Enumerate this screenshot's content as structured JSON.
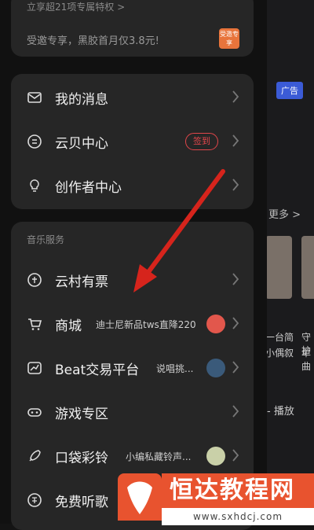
{
  "promo": {
    "line1": "立享超21项专属特权 >",
    "line2": "受邀专享，黑胶首月仅3.8元!",
    "badge": "受邀专享"
  },
  "menu_main": [
    {
      "label": "我的消息",
      "icon": "mail-icon"
    },
    {
      "label": "云贝中心",
      "icon": "coin-icon",
      "badge": "签到"
    },
    {
      "label": "创作者中心",
      "icon": "bulb-icon"
    }
  ],
  "music_services": {
    "title": "音乐服务",
    "items": [
      {
        "label": "云村有票",
        "icon": "ticket-icon"
      },
      {
        "label": "商城",
        "icon": "cart-icon",
        "note": "迪士尼新品tws直降220"
      },
      {
        "label": "Beat交易平台",
        "icon": "chart-icon",
        "note": "说唱挑..."
      },
      {
        "label": "游戏专区",
        "icon": "gamepad-icon"
      },
      {
        "label": "口袋彩铃",
        "icon": "rocket-icon",
        "note": "小编私藏铃声..."
      },
      {
        "label": "免费听歌",
        "icon": "free-icon"
      }
    ]
  },
  "background": {
    "ad_label": "广告",
    "more_label": "更多 >",
    "text1": "一台简",
    "text2": "小偶叙",
    "text3": "守护",
    "text4": "单曲",
    "play_label": "- 播放"
  },
  "watermark": {
    "brand": "恒达教程网",
    "site": "www.sxhdcj.com"
  },
  "colors": {
    "accent_red": "#e0464a",
    "brand_orange": "#e8532f"
  }
}
